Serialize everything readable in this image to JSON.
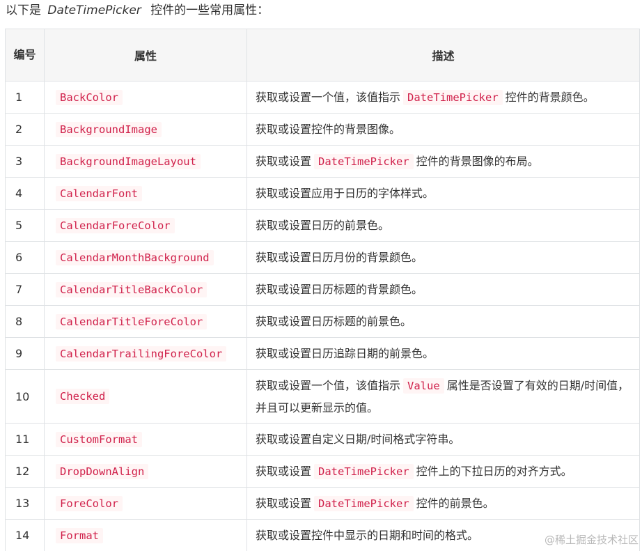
{
  "intro": {
    "prefix": "以下是",
    "class_name": "DateTimePicker",
    "suffix": "控件的一些常用属性："
  },
  "table": {
    "headers": [
      "编号",
      "属性",
      "描述"
    ],
    "rows": [
      {
        "num": "1",
        "prop": "BackColor",
        "desc": [
          {
            "t": "获取或设置一个值，该值指示"
          },
          {
            "c": "DateTimePicker"
          },
          {
            "t": "控件的背景颜色。"
          }
        ]
      },
      {
        "num": "2",
        "prop": "BackgroundImage",
        "desc": [
          {
            "t": "获取或设置控件的背景图像。"
          }
        ]
      },
      {
        "num": "3",
        "prop": "BackgroundImageLayout",
        "desc": [
          {
            "t": "获取或设置"
          },
          {
            "c": "DateTimePicker"
          },
          {
            "t": "控件的背景图像的布局。"
          }
        ]
      },
      {
        "num": "4",
        "prop": "CalendarFont",
        "desc": [
          {
            "t": "获取或设置应用于日历的字体样式。"
          }
        ]
      },
      {
        "num": "5",
        "prop": "CalendarForeColor",
        "desc": [
          {
            "t": "获取或设置日历的前景色。"
          }
        ]
      },
      {
        "num": "6",
        "prop": "CalendarMonthBackground",
        "desc": [
          {
            "t": "获取或设置日历月份的背景颜色。"
          }
        ]
      },
      {
        "num": "7",
        "prop": "CalendarTitleBackColor",
        "desc": [
          {
            "t": "获取或设置日历标题的背景颜色。"
          }
        ]
      },
      {
        "num": "8",
        "prop": "CalendarTitleForeColor",
        "desc": [
          {
            "t": "获取或设置日历标题的前景色。"
          }
        ]
      },
      {
        "num": "9",
        "prop": "CalendarTrailingForeColor",
        "desc": [
          {
            "t": "获取或设置日历追踪日期的前景色。"
          }
        ]
      },
      {
        "num": "10",
        "prop": "Checked",
        "tall": true,
        "desc": [
          {
            "t": "获取或设置一个值，该值指示"
          },
          {
            "c": "Value"
          },
          {
            "t": "属性是否设置了有效的日期/时间值，并且可以更新显示的值。"
          }
        ]
      },
      {
        "num": "11",
        "prop": "CustomFormat",
        "desc": [
          {
            "t": "获取或设置自定义日期/时间格式字符串。"
          }
        ]
      },
      {
        "num": "12",
        "prop": "DropDownAlign",
        "desc": [
          {
            "t": "获取或设置"
          },
          {
            "c": "DateTimePicker"
          },
          {
            "t": "控件上的下拉日历的对齐方式。"
          }
        ]
      },
      {
        "num": "13",
        "prop": "ForeColor",
        "desc": [
          {
            "t": "获取或设置"
          },
          {
            "c": "DateTimePicker"
          },
          {
            "t": "控件的前景色。"
          }
        ]
      },
      {
        "num": "14",
        "prop": "Format",
        "desc": [
          {
            "t": "获取或设置控件中显示的日期和时间的格式。"
          }
        ]
      }
    ]
  },
  "watermark": "@稀土掘金技术社区",
  "colors": {
    "code_text": "#d0204a",
    "code_bg": "#fff5f5",
    "header_bg": "#f6f6f6",
    "border": "#dfe2e5"
  }
}
